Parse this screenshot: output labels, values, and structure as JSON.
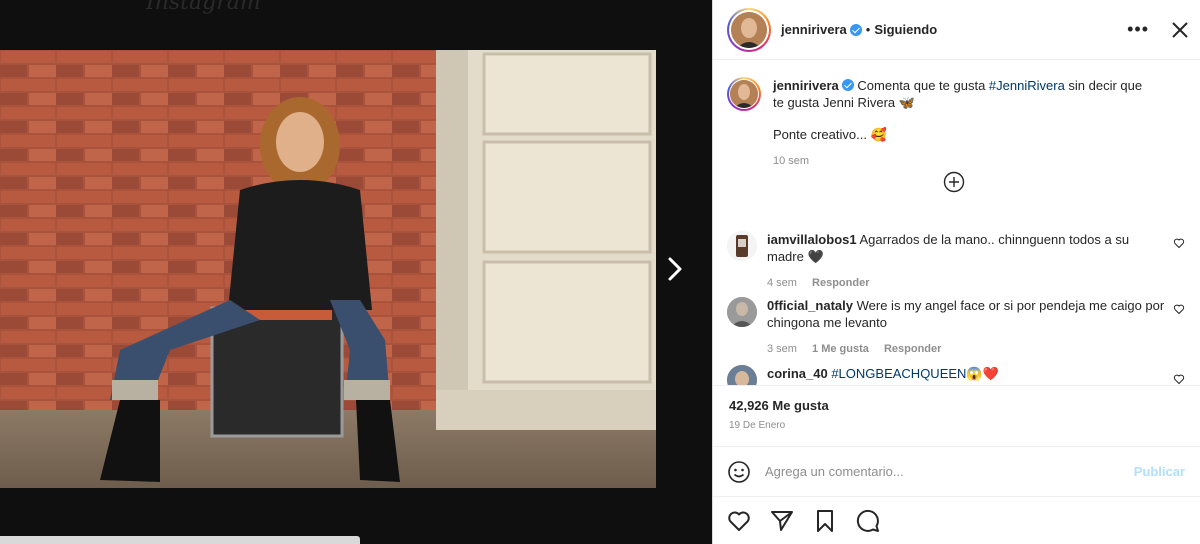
{
  "background": {
    "logo_text": "Instagram"
  },
  "post": {
    "username": "jennirivera",
    "follow_status": "Siguiendo",
    "caption": {
      "text_before": "Comenta que te gusta ",
      "hashtag": "#JenniRivera",
      "text_after": " sin decir que te gusta Jenni Rivera 🦋",
      "line2": "Ponte creativo... 🥰",
      "time": "10 sem"
    },
    "comments": [
      {
        "username": "iamvillalobos1",
        "text": "Agarrados de la mano.. chinnguenn todos a su madre 🖤",
        "time": "4 sem",
        "likes": "",
        "reply": "Responder"
      },
      {
        "username": "0fficial_nataly",
        "text": "Were is my angel face or si por pendeja me caigo por chingona me levanto",
        "time": "3 sem",
        "likes": "1 Me gusta",
        "reply": "Responder"
      },
      {
        "username": "corina_40",
        "hashtag": "#LONGBEACHQUEEN",
        "emoji": "😱❤️"
      }
    ],
    "likes": "42,926 Me gusta",
    "date": "19 De Enero",
    "add_comment": {
      "placeholder": "Agrega un comentario...",
      "publish": "Publicar"
    }
  },
  "icons": {
    "more": "more-options-icon",
    "close": "close-icon",
    "next": "chevron-right-icon",
    "add": "plus-circle-icon",
    "emoji": "emoji-icon",
    "like": "heart-icon",
    "share": "paper-plane-icon",
    "save": "bookmark-icon",
    "comment": "comment-icon"
  },
  "colors": {
    "link": "#00376b",
    "verified": "#3897f0",
    "publish": "#b2dffc",
    "meta": "#8e8e8e"
  }
}
